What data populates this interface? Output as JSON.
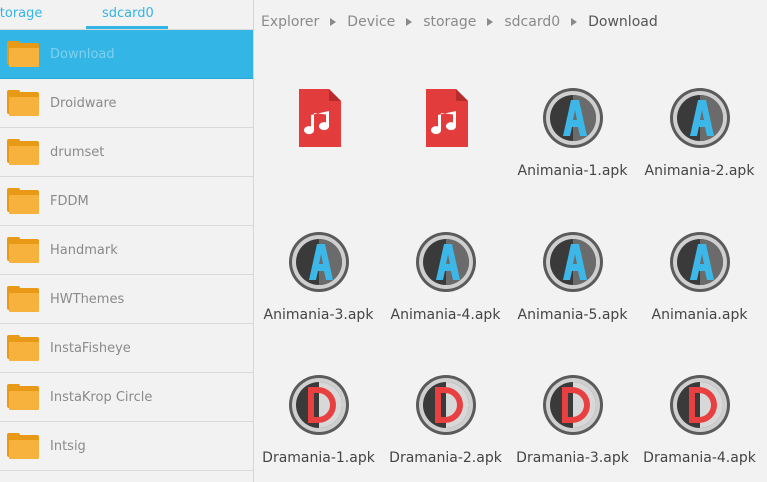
{
  "tabs": {
    "storage": "storage",
    "sdcard": "sdcard0"
  },
  "folders": [
    {
      "label": "Download"
    },
    {
      "label": "Droidware"
    },
    {
      "label": "drumset"
    },
    {
      "label": "FDDM"
    },
    {
      "label": "Handmark"
    },
    {
      "label": "HWThemes"
    },
    {
      "label": "InstaFisheye"
    },
    {
      "label": "InstaKrop Circle"
    },
    {
      "label": "Intsig"
    }
  ],
  "breadcrumb": [
    "Explorer",
    "Device",
    "storage",
    "sdcard0",
    "Download"
  ],
  "files": [
    {
      "name": "",
      "icon": "music-file-icon"
    },
    {
      "name": "",
      "icon": "music-file-icon"
    },
    {
      "name": "Animania-1.apk",
      "icon": "animania-app-icon"
    },
    {
      "name": "Animania-2.apk",
      "icon": "animania-app-icon"
    },
    {
      "name": "Animania-3.apk",
      "icon": "animania-app-icon"
    },
    {
      "name": "Animania-4.apk",
      "icon": "animania-app-icon"
    },
    {
      "name": "Animania-5.apk",
      "icon": "animania-app-icon"
    },
    {
      "name": "Animania.apk",
      "icon": "animania-app-icon"
    },
    {
      "name": "Dramania-1.apk",
      "icon": "dramania-app-icon"
    },
    {
      "name": "Dramania-2.apk",
      "icon": "dramania-app-icon"
    },
    {
      "name": "Dramania-3.apk",
      "icon": "dramania-app-icon"
    },
    {
      "name": "Dramania-4.apk",
      "icon": "dramania-app-icon"
    }
  ],
  "colors": {
    "accent": "#33b5e5",
    "folder": "#f7b13d",
    "music": "#e23c3c"
  }
}
